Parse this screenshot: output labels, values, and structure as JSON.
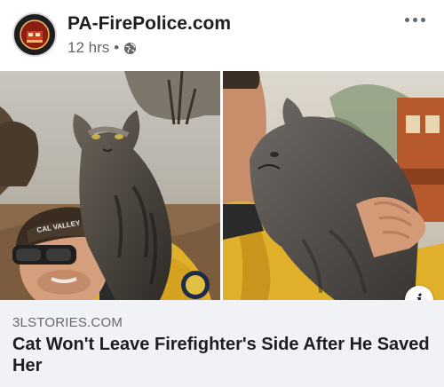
{
  "post": {
    "page_name": "PA-FirePolice.com",
    "time": "12 hrs",
    "separator": "•",
    "privacy_icon": "globe-icon",
    "more_icon": "more-dots-icon"
  },
  "photos": {
    "left_alt": "Firefighter with cat on shoulder",
    "right_alt": "Cat nuzzling firefighter",
    "hat_text": "CAL VALLEY"
  },
  "link_preview": {
    "domain": "3LSTORIES.COM",
    "title": "Cat Won't Leave Firefighter's Side After He Saved Her",
    "info_icon": "info-icon",
    "info_label": "i"
  },
  "colors": {
    "text_primary": "#1c1e21",
    "text_secondary": "#65676b",
    "preview_bg": "#f0f2f5",
    "uniform_yellow": "#e5b82a"
  }
}
